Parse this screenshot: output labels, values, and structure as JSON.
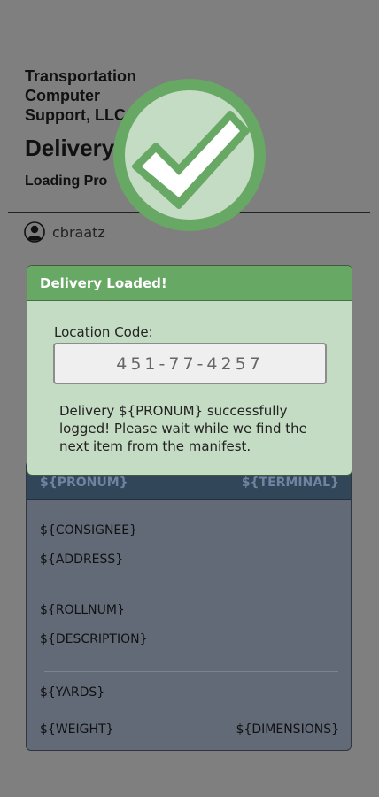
{
  "header": {
    "company": "Transportation Computer Support, LLC",
    "title": "Delivery",
    "subtitle": "Loading Pro"
  },
  "user": {
    "name": "cbraatz",
    "icon": "user-circle-icon"
  },
  "success_icon": "checkmark-icon",
  "colors": {
    "success": "#67a964",
    "modal_bg": "#c5dcc4",
    "card_header": "#314659"
  },
  "modal": {
    "title": "Delivery Loaded!",
    "location_label": "Location Code:",
    "location_value": "451-77-4257",
    "message": "Delivery ${PRONUM} successfully logged! Please wait while we find the next item from the manifest."
  },
  "card": {
    "pronum": "${PRONUM}",
    "terminal": "${TERMINAL}",
    "consignee": "${CONSIGNEE}",
    "address": "${ADDRESS}",
    "rollnum": "${ROLLNUM}",
    "description": "${DESCRIPTION}",
    "yards": "${YARDS}",
    "weight": "${WEIGHT}",
    "dimensions": "${DIMENSIONS}"
  }
}
